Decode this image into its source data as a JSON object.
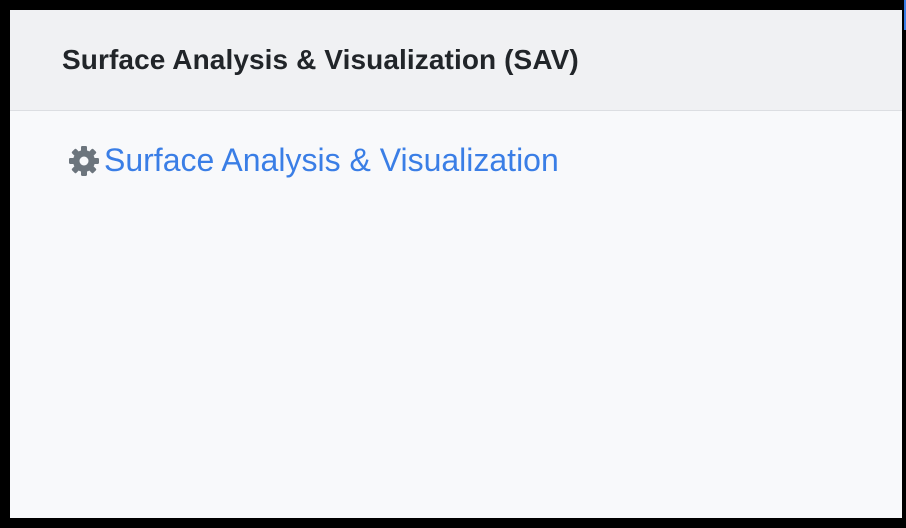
{
  "card": {
    "title": "Surface Analysis & Visualization (SAV)"
  },
  "links": [
    {
      "label": "Surface Analysis & Visualization",
      "icon": "gear-icon",
      "color": "#3a7ee6"
    }
  ],
  "colors": {
    "header_bg": "#f0f1f3",
    "body_bg": "#f8f9fb",
    "title_text": "#212529",
    "icon": "#6c757d",
    "link": "#3a7ee6"
  }
}
